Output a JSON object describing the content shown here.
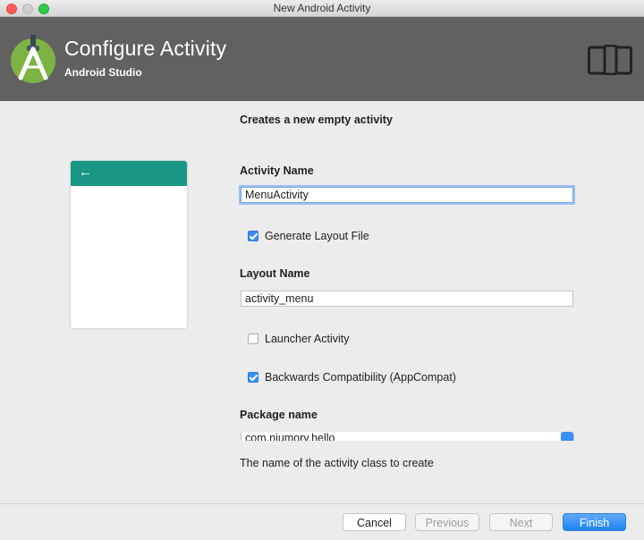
{
  "window": {
    "title": "New Android Activity"
  },
  "header": {
    "title": "Configure Activity",
    "subtitle": "Android Studio",
    "logo_icon": "android-studio-logo-icon",
    "device_icon": "phone-tablet-icon",
    "accent": "#616161"
  },
  "form": {
    "description": "Creates a new empty activity",
    "activity_name_label": "Activity Name",
    "activity_name_value": "MenuActivity",
    "generate_layout": {
      "label": "Generate Layout File",
      "checked": true
    },
    "layout_name_label": "Layout Name",
    "layout_name_value": "activity_menu",
    "launcher_activity": {
      "label": "Launcher Activity",
      "checked": false
    },
    "backwards_compat": {
      "label": "Backwards Compatibility (AppCompat)",
      "checked": true
    },
    "package_name_label": "Package name",
    "package_name_value": "com.niumory.hello",
    "hint": "The name of the activity class to create"
  },
  "preview": {
    "back_icon": "arrow-left-icon",
    "appbar_color": "#1a9684"
  },
  "footer": {
    "cancel": "Cancel",
    "previous": "Previous",
    "next": "Next",
    "finish": "Finish"
  }
}
